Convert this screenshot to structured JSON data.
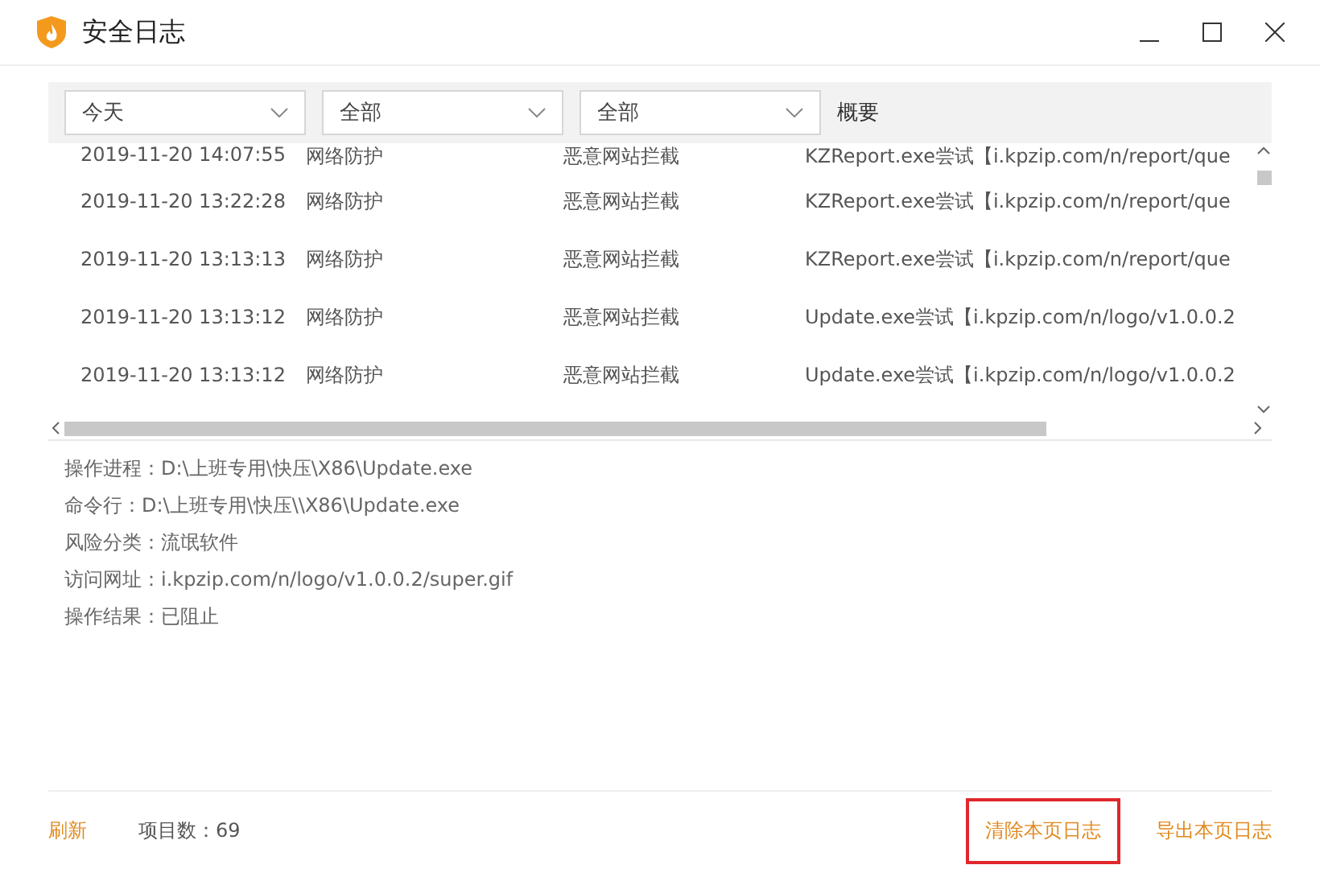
{
  "window": {
    "title": "安全日志"
  },
  "filters": [
    {
      "value": "今天"
    },
    {
      "value": "全部"
    },
    {
      "value": "全部"
    }
  ],
  "summary_header": "概要",
  "rows": [
    {
      "time": "2019-11-20 14:07:55",
      "module": "网络防护",
      "type": "恶意网站拦截",
      "summary": "KZReport.exe尝试【i.kpzip.com/n/report/que"
    },
    {
      "time": "2019-11-20 13:22:28",
      "module": "网络防护",
      "type": "恶意网站拦截",
      "summary": "KZReport.exe尝试【i.kpzip.com/n/report/que"
    },
    {
      "time": "2019-11-20 13:13:13",
      "module": "网络防护",
      "type": "恶意网站拦截",
      "summary": "KZReport.exe尝试【i.kpzip.com/n/report/que"
    },
    {
      "time": "2019-11-20 13:13:12",
      "module": "网络防护",
      "type": "恶意网站拦截",
      "summary": "Update.exe尝试【i.kpzip.com/n/logo/v1.0.0.2"
    },
    {
      "time": "2019-11-20 13:13:12",
      "module": "网络防护",
      "type": "恶意网站拦截",
      "summary": "Update.exe尝试【i.kpzip.com/n/logo/v1.0.0.2"
    }
  ],
  "details": [
    "操作进程：D:\\上班专用\\快压\\X86\\Update.exe",
    "命令行：D:\\上班专用\\快压\\\\X86\\Update.exe",
    "风险分类：流氓软件",
    "访问网址：i.kpzip.com/n/logo/v1.0.0.2/super.gif",
    "操作结果：已阻止"
  ],
  "footer": {
    "refresh": "刷新",
    "count": "项目数：69",
    "actions": [
      {
        "label": "清除本页日志",
        "highlighted": true
      },
      {
        "label": "导出本页日志",
        "highlighted": false
      }
    ]
  }
}
